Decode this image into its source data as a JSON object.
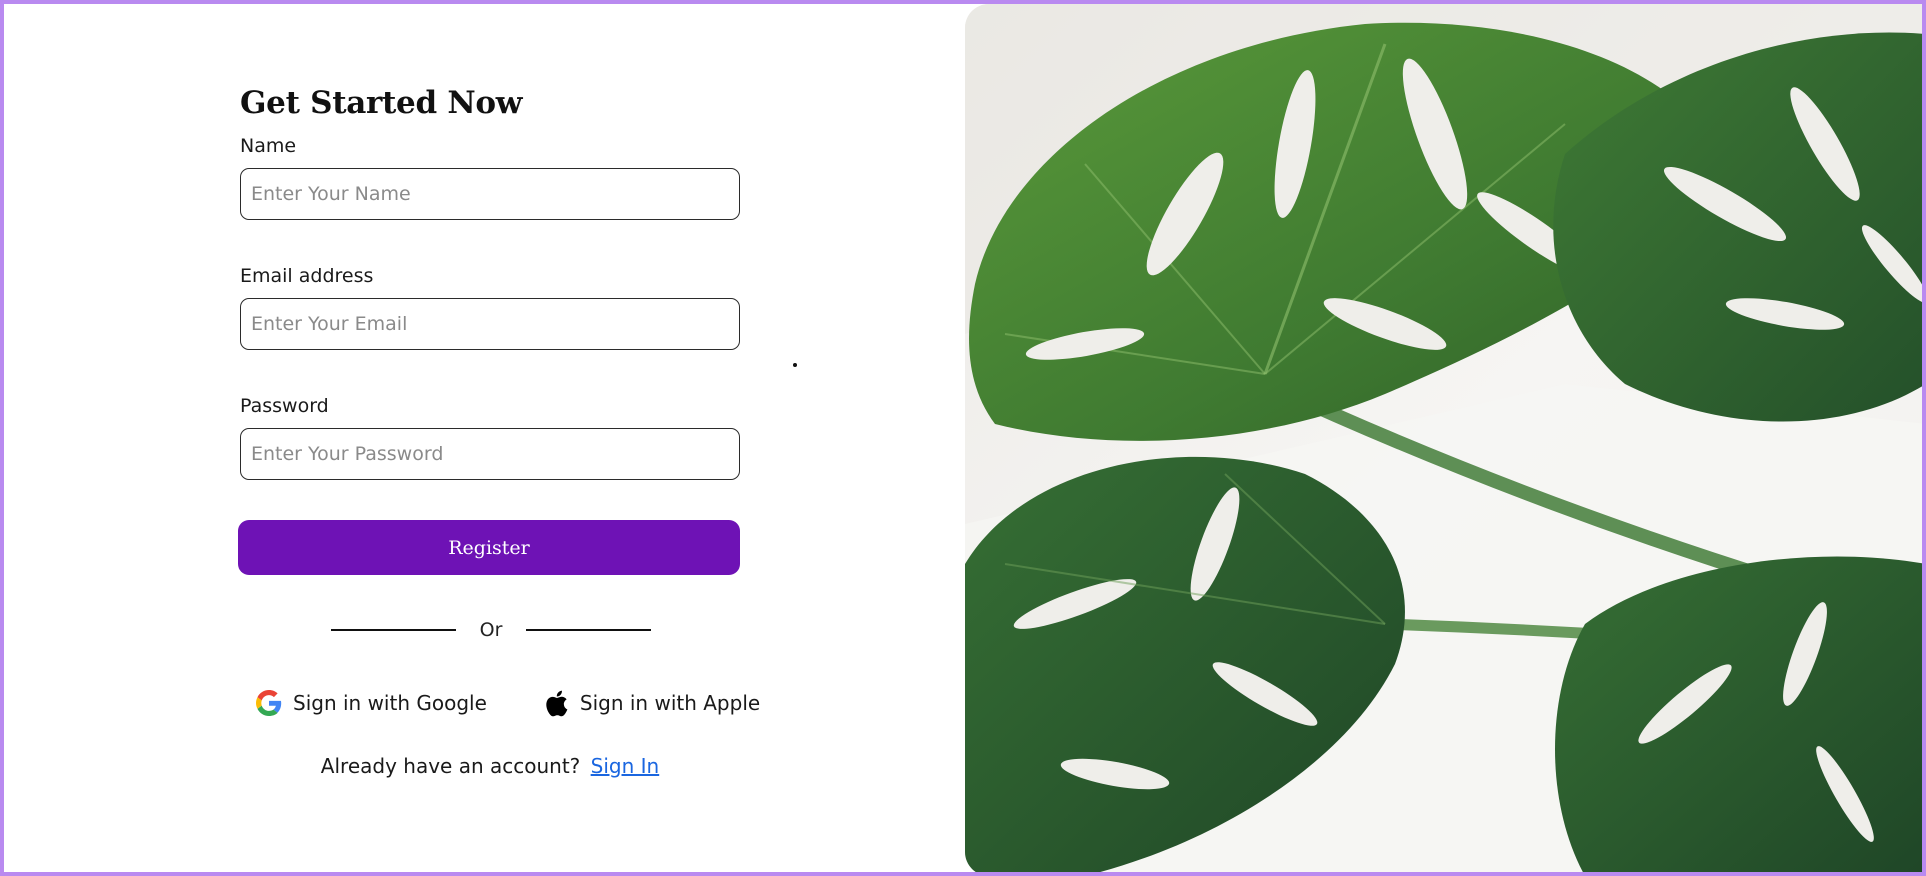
{
  "form": {
    "title": "Get Started Now",
    "name_label": "Name",
    "name_placeholder": "Enter Your Name",
    "email_label": "Email address",
    "email_placeholder": "Enter Your Email",
    "password_label": "Password",
    "password_placeholder": "Enter Your Password",
    "register_label": "Register",
    "divider_text": "Or",
    "google_label": "Sign in with Google",
    "apple_label": "Sign in with Apple",
    "account_prompt": "Already have an account?",
    "signin_link": "Sign In"
  },
  "icons": {
    "google": "google-icon",
    "apple": "apple-icon"
  },
  "colors": {
    "accent": "#6e12b5",
    "link": "#1a66e0",
    "frame_border": "#b98af0",
    "leaf_dark": "#2f5f2c",
    "leaf_light": "#4f8f3a"
  }
}
